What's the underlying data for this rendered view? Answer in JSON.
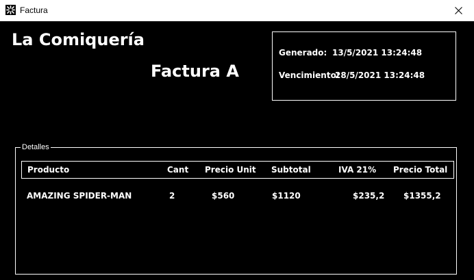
{
  "window": {
    "title": "Factura",
    "icon": "app-icon",
    "close_icon": "close-icon"
  },
  "header": {
    "store_name": "La Comiquería",
    "invoice_type": "Factura A"
  },
  "dates": {
    "generated_label": "Generado:",
    "generated_value": "13/5/2021 13:24:48",
    "due_label": "Vencimiento:",
    "due_value": "28/5/2021 13:24:48"
  },
  "details": {
    "group_label": "Detalles",
    "columns": [
      "Producto",
      "Cant",
      "Precio Unit",
      "Subtotal",
      "IVA 21%",
      "Precio Total"
    ],
    "rows": [
      [
        "AMAZING SPIDER-MAN",
        "2",
        "$560",
        "$1120",
        "$235,2",
        "$1355,2"
      ]
    ]
  },
  "colors": {
    "background": "#000000",
    "foreground": "#ffffff",
    "titlebar": "#ffffff"
  }
}
